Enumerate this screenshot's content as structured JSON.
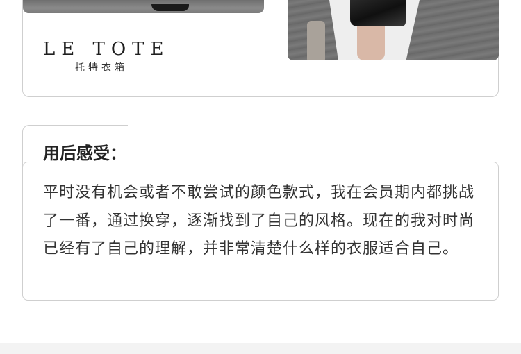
{
  "brand": {
    "name_en": "LE TOTE",
    "name_cn": "托特衣箱"
  },
  "review": {
    "title": "用后感受：",
    "text": "平时没有机会或者不敢尝试的颜色款式，我在会员期内都挑战了一番，通过换穿，逐渐找到了自己的风格。现在的我对时尚已经有了自己的理解，并非常清楚什么样的衣服适合自己。"
  },
  "colors": {
    "border": "#cfcfcf",
    "text": "#333333",
    "title": "#222222",
    "footer": "#f3f3f3"
  }
}
